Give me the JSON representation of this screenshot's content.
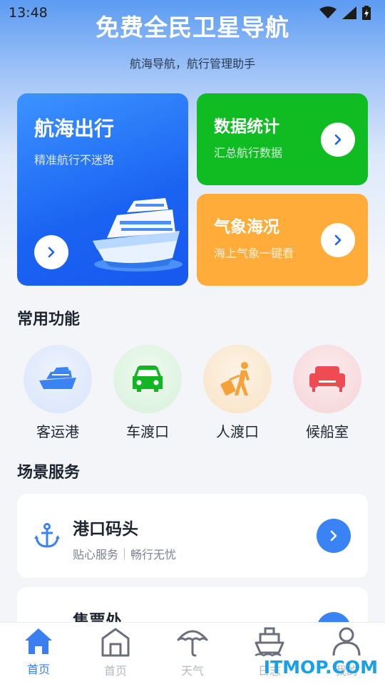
{
  "status_bar": {
    "time": "13:48"
  },
  "header": {
    "title": "免费全民卫星导航",
    "subtitle": "航海导航，航行管理助手"
  },
  "cards": {
    "navigation": {
      "title": "航海出行",
      "desc": "精准航行不迷路"
    },
    "data": {
      "title": "数据统计",
      "desc": "汇总航行数据"
    },
    "weather": {
      "title": "气象海况",
      "desc": "海上气象一键看"
    }
  },
  "common_functions": {
    "title": "常用功能",
    "items": [
      {
        "label": "客运港",
        "icon": "cruise-ship-icon"
      },
      {
        "label": "车渡口",
        "icon": "car-icon"
      },
      {
        "label": "人渡口",
        "icon": "traveler-icon"
      },
      {
        "label": "候船室",
        "icon": "sofa-icon"
      }
    ]
  },
  "scene_services": {
    "title": "场景服务",
    "items": [
      {
        "title": "港口码头",
        "desc_a": "贴心服务",
        "desc_b": "畅行无忧",
        "icon": "anchor-icon"
      },
      {
        "title": "售票处",
        "icon": "ticket-icon"
      }
    ]
  },
  "tabbar": {
    "tabs": [
      {
        "label": "首页",
        "icon": "home-icon",
        "active": true
      },
      {
        "label": "首页",
        "icon": "building-icon",
        "active": false
      },
      {
        "label": "天气",
        "icon": "umbrella-icon",
        "active": false
      },
      {
        "label": "日志",
        "icon": "ship-icon",
        "active": false
      },
      {
        "label": "我的",
        "icon": "user-icon",
        "active": false
      }
    ]
  },
  "watermark": "ITMOP.COM",
  "colors": {
    "primary_blue": "#1a63f2",
    "green": "#0fbd22",
    "orange": "#ffac3b",
    "tab_active": "#3a7ff2"
  }
}
